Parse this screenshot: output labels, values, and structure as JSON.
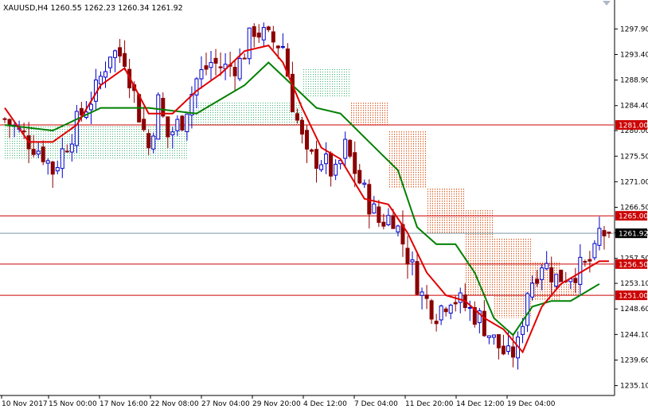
{
  "chart_data": {
    "type": "candlestick",
    "symbol_line": "XAUUSD,H4  1260.55 1262.23 1260.34 1261.92",
    "colors": {
      "up_candle": "#0000cc",
      "down_candle": "#8b0000",
      "tenkan": "#e00000",
      "kijun": "#008000",
      "cloud_bull": "#3cb371",
      "cloud_bear": "#e05a1e",
      "hline": "#cc0000",
      "current_line": "#7a9aa8",
      "label_bg": "#cc0000",
      "current_label_bg": "#000000"
    },
    "ylim": [
      1233.5,
      1303.0
    ],
    "y_ticks": [
      "1297.90",
      "1293.40",
      "1288.90",
      "1284.40",
      "1280.00",
      "1275.50",
      "1271.00",
      "1266.50",
      "1262.00",
      "1257.50",
      "1253.10",
      "1248.60",
      "1244.10",
      "1239.60",
      "1235.10"
    ],
    "x_ticks": [
      "10 Nov 2017",
      "15 Nov 00:00",
      "17 Nov 16:00",
      "22 Nov 08:00",
      "27 Nov 04:00",
      "29 Nov 20:00",
      "4 Dec 12:00",
      "7 Dec 04:00",
      "11 Dec 20:00",
      "14 Dec 12:00",
      "19 Dec 04:00"
    ],
    "levels": [
      {
        "label": "1281.00",
        "value": 1281.0
      },
      {
        "label": "1265.00",
        "value": 1265.0
      },
      {
        "label": "1256.50",
        "value": 1256.5
      },
      {
        "label": "1251.00",
        "value": 1251.0
      }
    ],
    "current": {
      "label": "1261.92",
      "value": 1261.92
    },
    "close_path": [
      [
        0,
        1282
      ],
      [
        4,
        1279
      ],
      [
        8,
        1276
      ],
      [
        10,
        1273
      ],
      [
        13,
        1278
      ],
      [
        16,
        1283
      ],
      [
        19,
        1287
      ],
      [
        22,
        1294
      ],
      [
        25,
        1293
      ],
      [
        28,
        1283
      ],
      [
        30,
        1277
      ],
      [
        32,
        1285
      ],
      [
        34,
        1279
      ],
      [
        37,
        1282
      ],
      [
        40,
        1289
      ],
      [
        43,
        1292
      ],
      [
        46,
        1291
      ],
      [
        49,
        1292
      ],
      [
        52,
        1298
      ],
      [
        55,
        1296
      ],
      [
        58,
        1295
      ],
      [
        60,
        1285
      ],
      [
        63,
        1275
      ],
      [
        66,
        1275
      ],
      [
        69,
        1272
      ],
      [
        71,
        1277
      ],
      [
        73,
        1273
      ],
      [
        75,
        1269
      ],
      [
        78,
        1264
      ],
      [
        81,
        1265
      ],
      [
        84,
        1258
      ],
      [
        87,
        1251
      ],
      [
        90,
        1248
      ],
      [
        93,
        1251
      ],
      [
        96,
        1249
      ],
      [
        99,
        1247
      ],
      [
        102,
        1243
      ],
      [
        105,
        1240
      ],
      [
        107,
        1242
      ],
      [
        109,
        1252
      ],
      [
        112,
        1257
      ],
      [
        115,
        1254
      ],
      [
        118,
        1255
      ],
      [
        121,
        1256
      ],
      [
        123,
        1258
      ],
      [
        124,
        1262
      ],
      [
        126,
        1261.92
      ]
    ],
    "tenkan": [
      [
        0,
        1284
      ],
      [
        5,
        1278
      ],
      [
        10,
        1278
      ],
      [
        15,
        1281
      ],
      [
        20,
        1288
      ],
      [
        25,
        1291
      ],
      [
        30,
        1283
      ],
      [
        35,
        1283
      ],
      [
        40,
        1287
      ],
      [
        45,
        1290
      ],
      [
        50,
        1294
      ],
      [
        55,
        1295
      ],
      [
        58,
        1292
      ],
      [
        62,
        1284
      ],
      [
        66,
        1277
      ],
      [
        70,
        1275
      ],
      [
        75,
        1268
      ],
      [
        80,
        1267
      ],
      [
        84,
        1262
      ],
      [
        88,
        1255
      ],
      [
        92,
        1251
      ],
      [
        96,
        1250
      ],
      [
        100,
        1247
      ],
      [
        104,
        1245
      ],
      [
        108,
        1241
      ],
      [
        112,
        1249
      ],
      [
        116,
        1253
      ],
      [
        120,
        1255
      ],
      [
        124,
        1257
      ],
      [
        126,
        1257
      ]
    ],
    "kijun": [
      [
        0,
        1281
      ],
      [
        10,
        1280
      ],
      [
        20,
        1284
      ],
      [
        30,
        1284
      ],
      [
        40,
        1283
      ],
      [
        50,
        1288
      ],
      [
        55,
        1292
      ],
      [
        60,
        1288
      ],
      [
        65,
        1284
      ],
      [
        70,
        1283
      ],
      [
        76,
        1278
      ],
      [
        82,
        1273
      ],
      [
        86,
        1263
      ],
      [
        90,
        1260
      ],
      [
        94,
        1260
      ],
      [
        98,
        1255
      ],
      [
        102,
        1247
      ],
      [
        106,
        1244
      ],
      [
        110,
        1249
      ],
      [
        114,
        1250
      ],
      [
        118,
        1250
      ],
      [
        122,
        1252
      ],
      [
        124,
        1253
      ]
    ],
    "cloud_bull": [
      {
        "from": 0,
        "to": 38,
        "top": 1281,
        "bottom": 1275
      },
      {
        "from": 38,
        "to": 62,
        "top": 1285,
        "bottom": 1281
      },
      {
        "from": 62,
        "to": 72,
        "top": 1291,
        "bottom": 1286
      }
    ],
    "cloud_bear": [
      {
        "from": 72,
        "to": 80,
        "top": 1285,
        "bottom": 1281
      },
      {
        "from": 80,
        "to": 88,
        "top": 1280,
        "bottom": 1270
      },
      {
        "from": 88,
        "to": 96,
        "top": 1270,
        "bottom": 1262
      },
      {
        "from": 96,
        "to": 102,
        "top": 1266,
        "bottom": 1251
      },
      {
        "from": 102,
        "to": 110,
        "top": 1261,
        "bottom": 1247
      },
      {
        "from": 110,
        "to": 116,
        "top": 1257,
        "bottom": 1250
      },
      {
        "from": 116,
        "to": 120,
        "top": 1253,
        "bottom": 1251
      }
    ],
    "grid": false,
    "legend": "none"
  }
}
